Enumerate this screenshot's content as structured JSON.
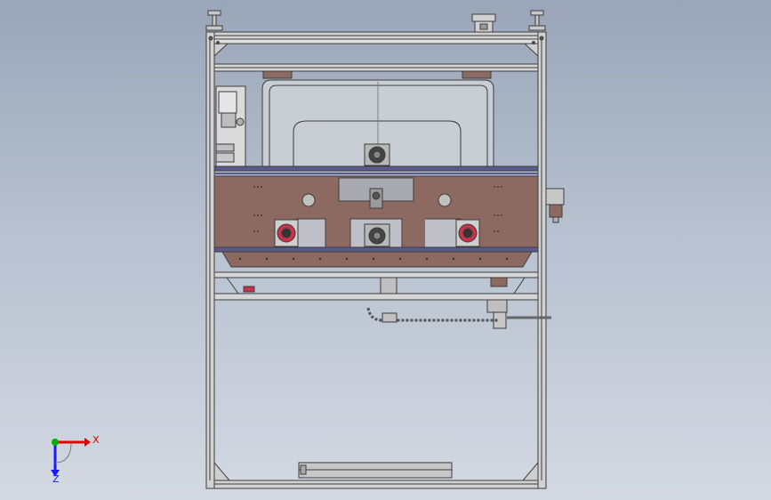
{
  "viewport": {
    "background_top": "#9aa6b8",
    "background_bottom": "#d4d9e2"
  },
  "model": {
    "frame_color": "#d2d2d2",
    "frame_edge_color": "#3c3c3c",
    "plate_color": "#8c6a62",
    "rail_color": "#5a5a8c",
    "highlight_color": "#c8324b"
  },
  "triad": {
    "x_label": "X",
    "z_label": "Z",
    "x_color": "#e00000",
    "y_color": "#00b000",
    "z_color": "#1a1aff"
  }
}
